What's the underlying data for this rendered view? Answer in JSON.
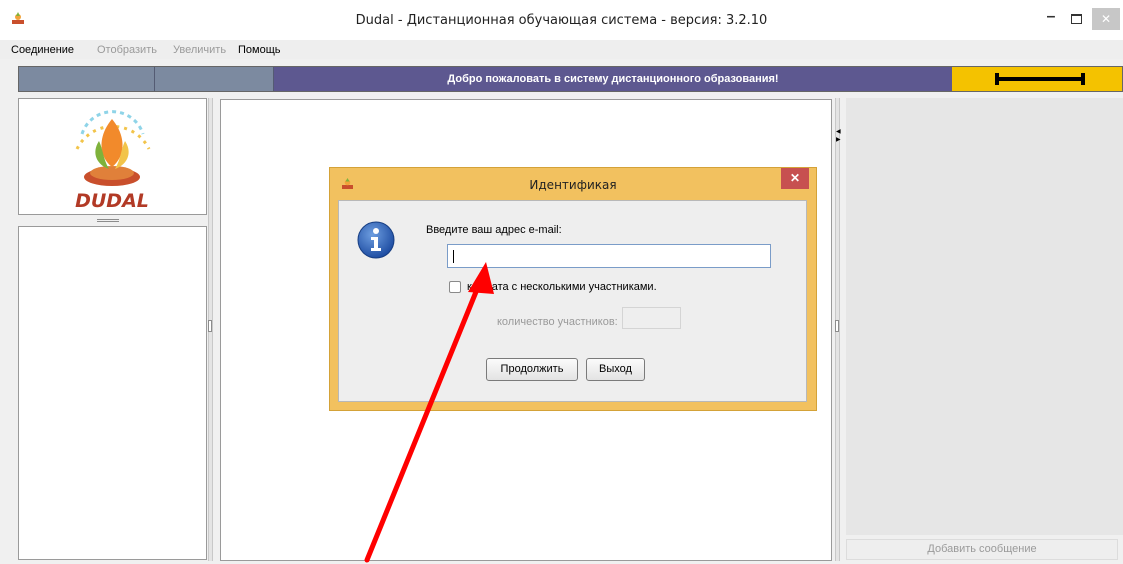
{
  "window": {
    "title": "Dudal - Дистанционная обучающая система - версия: 3.2.10",
    "close_glyph": "✕",
    "min_glyph": "–"
  },
  "menu": {
    "items": [
      {
        "label": "Соединение",
        "enabled": true
      },
      {
        "label": "Отобразить",
        "enabled": false
      },
      {
        "label": "Увеличить",
        "enabled": false
      },
      {
        "label": "Помощь",
        "enabled": true
      }
    ]
  },
  "status": {
    "banner": "Добро пожаловать в систему дистанционного образования!",
    "icon": "progress-bar-icon"
  },
  "logo": {
    "text": "DUDAL",
    "icon": "dudal-logo-icon"
  },
  "chat": {
    "add_message_label": "Добавить сообщение"
  },
  "dialog": {
    "title": "Идентификая",
    "close_glyph": "✕",
    "icon": "info-icon",
    "prompt": "Введите ваш адрес e-mail:",
    "email_value": "",
    "checkbox_label": "комната с несколькими участниками.",
    "checkbox_checked": false,
    "count_label": "количество участников:",
    "count_value": "",
    "continue_label": "Продолжить",
    "exit_label": "Выход"
  },
  "annotation": {
    "color": "#ff0000"
  }
}
